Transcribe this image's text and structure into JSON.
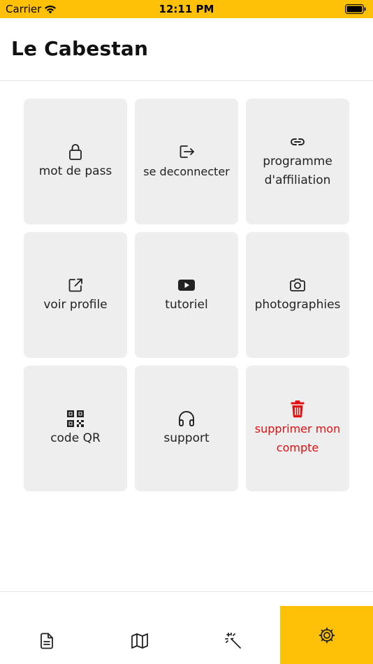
{
  "status_bar": {
    "carrier": "Carrier",
    "time": "12:11 PM"
  },
  "header": {
    "title": "Le Cabestan"
  },
  "tiles": [
    {
      "label": "mot de pass",
      "icon": "lock-icon"
    },
    {
      "label": "se deconnecter",
      "icon": "logout-icon"
    },
    {
      "label": "programme d'affiliation",
      "icon": "link-icon"
    },
    {
      "label": "voir profile",
      "icon": "external-link-icon"
    },
    {
      "label": "tutoriel",
      "icon": "youtube-icon"
    },
    {
      "label": "photographies",
      "icon": "camera-icon"
    },
    {
      "label": "code QR",
      "icon": "qr-code-icon"
    },
    {
      "label": "support",
      "icon": "headphones-icon"
    },
    {
      "label": "supprimer mon compte",
      "icon": "trash-icon"
    }
  ],
  "tabbar": {
    "items": [
      {
        "icon": "document-icon",
        "active": false
      },
      {
        "icon": "map-icon",
        "active": false
      },
      {
        "icon": "magic-wand-icon",
        "active": false
      },
      {
        "icon": "gear-icon",
        "active": true
      }
    ]
  },
  "colors": {
    "accent": "#ffc107",
    "tile_bg": "#eeeeee",
    "danger": "#e01010"
  }
}
